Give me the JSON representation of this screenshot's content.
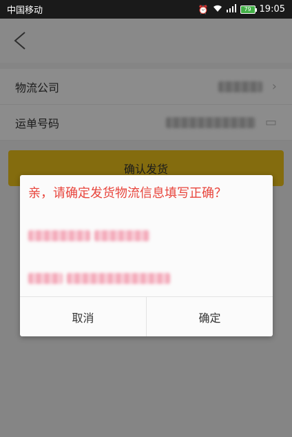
{
  "status_bar": {
    "carrier": "中国移动",
    "battery_level": "79",
    "time": "19:05"
  },
  "form": {
    "rows": [
      {
        "label": "物流公司"
      },
      {
        "label": "运单号码"
      }
    ]
  },
  "confirm_button": {
    "label": "确认发货"
  },
  "dialog": {
    "title": "亲，请确定发货物流信息填写正确？",
    "cancel_label": "取消",
    "ok_label": "确定"
  },
  "colors": {
    "accent": "#f0c51a",
    "dialog_text": "#e8453c"
  },
  "icons": {
    "back": "back-arrow-icon",
    "alarm": "alarm-icon",
    "wifi": "wifi-icon",
    "signal": "signal-icon",
    "battery": "battery-icon"
  }
}
